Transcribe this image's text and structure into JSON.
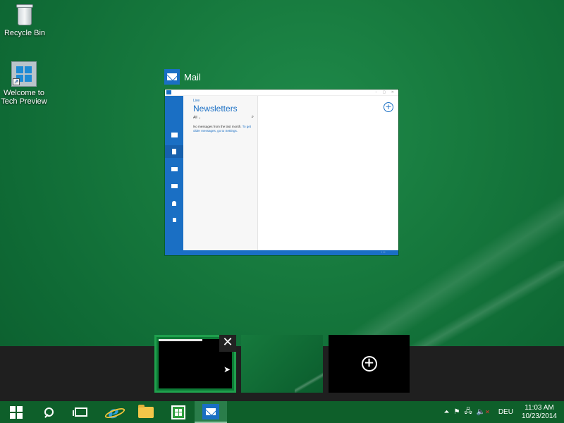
{
  "desktop": {
    "icons": [
      {
        "label": "Recycle Bin",
        "icon": "recycle-bin-icon"
      },
      {
        "label": "Welcome to Tech Preview",
        "icon": "tech-preview-icon"
      }
    ]
  },
  "task_view": {
    "window_title": "Mail",
    "mail_preview": {
      "account": "Live",
      "folder": "Newsletters",
      "filter": "All ⌄",
      "empty_message_prefix": "No messages from the last month.",
      "empty_message_link": "To get older messages, go to Settings.",
      "new_button": "+"
    }
  },
  "virtual_desktops": {
    "close_label": "✕",
    "add_label": "+"
  },
  "taskbar": {
    "apps": [
      "start",
      "search",
      "task-view",
      "internet-explorer",
      "file-explorer",
      "store",
      "mail"
    ],
    "tray": {
      "overflow": "⏶",
      "language": "DEU",
      "time": "11:03 AM",
      "date": "10/23/2014"
    }
  },
  "colors": {
    "accent_blue": "#1a6fc4",
    "desktop_green": "#177a3e",
    "taskbar_green": "#0e5f2a",
    "active_desktop_border": "#1fa04d"
  }
}
